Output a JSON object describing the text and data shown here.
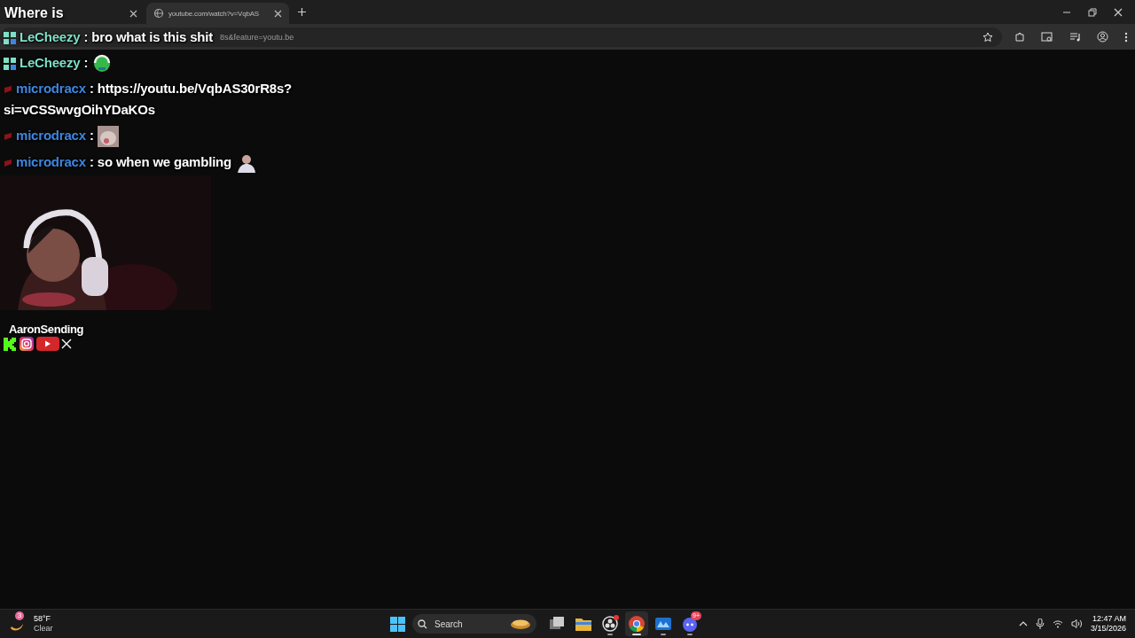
{
  "browser": {
    "tabs": [
      {
        "title": "Where is",
        "selected": false
      },
      {
        "title": "youtube.com/watch?v=VqbAS",
        "selected": true
      }
    ],
    "address": "8s&feature=youtu.be"
  },
  "chat": [
    {
      "user": "LeCheezy",
      "color": "#7ee0c6",
      "badge": {
        "kind": "grid"
      },
      "parts": [
        {
          "kind": "text",
          "text": ": bro what is this shit"
        }
      ]
    },
    {
      "user": "LeCheezy",
      "color": "#7ee0c6",
      "badge": {
        "kind": "grid"
      },
      "parts": [
        {
          "kind": "text",
          "text": ":"
        },
        {
          "kind": "blob"
        }
      ]
    },
    {
      "user": "microdracx",
      "color": "#3d86e0",
      "badge": {
        "kind": "flag"
      },
      "parts": [
        {
          "kind": "text",
          "text": ": https://youtu.be/VqbAS30rR8s?"
        },
        {
          "kind": "text",
          "text": "si=vCSSwvgOihYDaKOs"
        }
      ]
    },
    {
      "user": "microdracx",
      "color": "#3d86e0",
      "badge": {
        "kind": "flag"
      },
      "parts": [
        {
          "kind": "text",
          "text": ":"
        },
        {
          "kind": "square"
        }
      ]
    },
    {
      "user": "microdracx",
      "color": "#3d86e0",
      "badge": {
        "kind": "flag"
      },
      "parts": [
        {
          "kind": "text",
          "text": ": so when we gambling"
        },
        {
          "kind": "figure"
        }
      ]
    }
  ],
  "streamer": {
    "name": "AaronSending",
    "socials": [
      {
        "kind": "kick"
      },
      {
        "kind": "instagram"
      },
      {
        "kind": "youtube"
      },
      {
        "kind": "x"
      }
    ]
  },
  "taskbar": {
    "weather": {
      "badge": "3",
      "temperature": "58°F",
      "condition": "Clear"
    },
    "search": {
      "placeholder": "Search"
    },
    "apps": [
      {
        "kind": "taskview",
        "running": false,
        "selected": false
      },
      {
        "kind": "files",
        "running": false,
        "selected": false
      },
      {
        "kind": "recorder",
        "running": true,
        "selected": false
      },
      {
        "kind": "browser",
        "running": true,
        "selected": true
      },
      {
        "kind": "monitor",
        "running": true,
        "selected": false
      },
      {
        "kind": "chat",
        "running": true,
        "selected": false,
        "badge": "9+"
      }
    ],
    "time": "12:47 AM",
    "date": "3/15/2026"
  }
}
